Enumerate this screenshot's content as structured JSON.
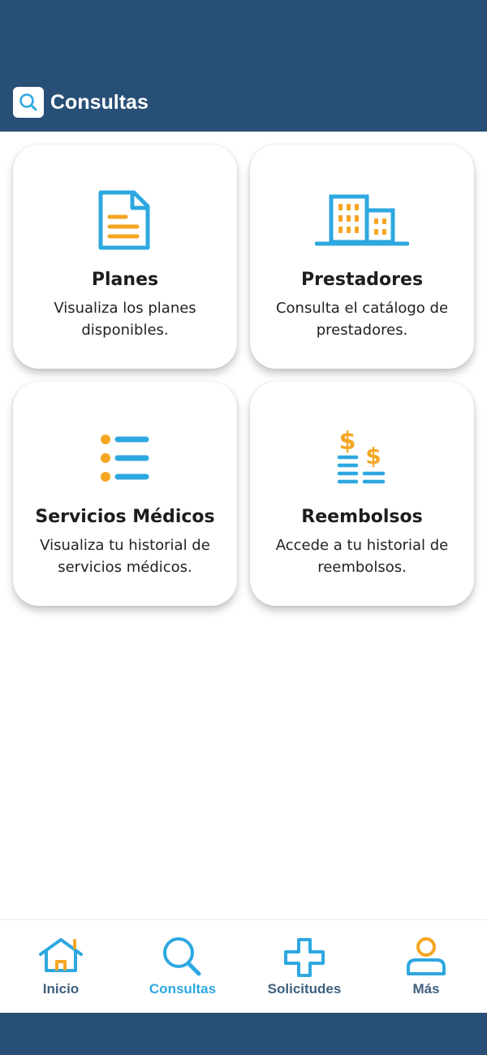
{
  "header": {
    "title": "Consultas",
    "title_icon": "search-icon"
  },
  "cards": [
    {
      "title": "Planes",
      "description": "Visualiza los planes disponibles.",
      "icon": "document-icon"
    },
    {
      "title": "Prestadores",
      "description": "Consulta el catálogo de prestadores.",
      "icon": "buildings-icon"
    },
    {
      "title": "Servicios Médicos",
      "description": "Visualiza tu historial de servicios médicos.",
      "icon": "list-icon"
    },
    {
      "title": "Reembolsos",
      "description": "Accede a tu historial de reembolsos.",
      "icon": "money-stack-icon"
    }
  ],
  "tabs": [
    {
      "label": "Inicio",
      "icon": "home-icon",
      "active": false
    },
    {
      "label": "Consultas",
      "icon": "search-icon",
      "active": true
    },
    {
      "label": "Solicitudes",
      "icon": "plus-icon",
      "active": false
    },
    {
      "label": "Más",
      "icon": "user-icon",
      "active": false
    }
  ],
  "colors": {
    "header_bg": "#285076",
    "accent_blue": "#2ea8e0",
    "accent_orange": "#f5a623",
    "tab_inactive": "#3f5f7e"
  }
}
